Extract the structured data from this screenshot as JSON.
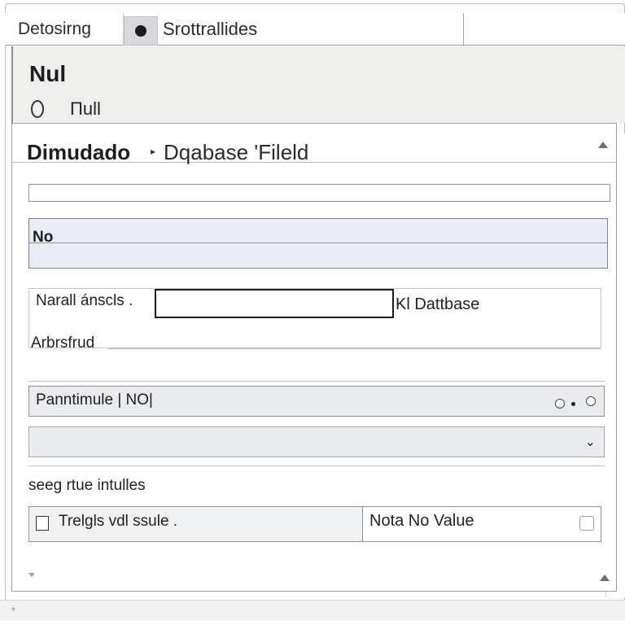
{
  "tabs": {
    "first_label": "Detosirng",
    "second_label": "Srottrallides"
  },
  "header": {
    "title": "Nul",
    "subtitle": "Πull"
  },
  "breadcrumb": {
    "main": "Dimudado",
    "separator": "▸",
    "sub": "Dqabase 'Fileld"
  },
  "form": {
    "select_value": "No",
    "name_label": "Narall ánscls .",
    "name_value": "",
    "database_label": "Kl Dattbase",
    "arch_label": "Arbrsfrud",
    "pan_label": "Panntimule | NO|",
    "dropdown_value": "",
    "section_label": "seeg rtue intulles",
    "row_left": "Trelgls vdl ssule .",
    "row_right": "Nota No Value"
  },
  "icons": {
    "tab_dot": "record-dot-icon",
    "caret_up": "caret-up-icon",
    "caret_down": "chevron-down-icon"
  },
  "colors": {
    "select_bg": "#e9ecf3",
    "header_bg": "#efefed",
    "border": "#8e939a"
  }
}
